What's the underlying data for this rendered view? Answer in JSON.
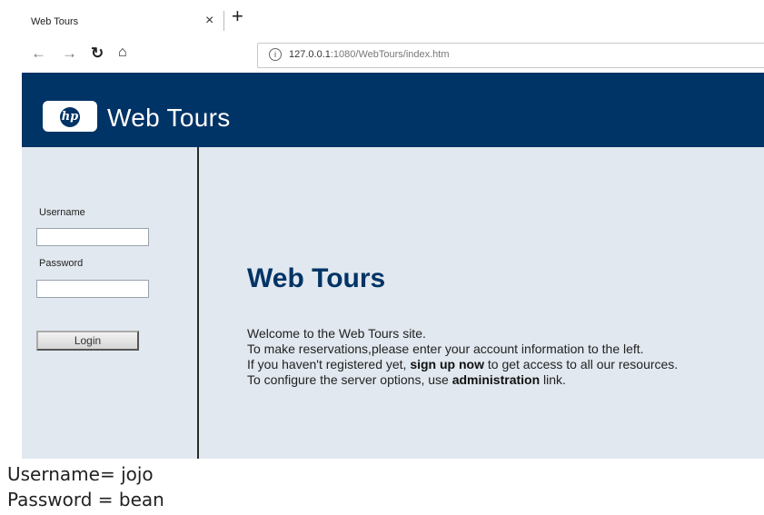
{
  "browser": {
    "tab_title": "Web Tours",
    "tab_close": "×",
    "new_tab": "+",
    "url_host": "127.0.0.1",
    "url_rest": ":1080/WebTours/index.htm"
  },
  "header": {
    "logo_text": "hp",
    "title": "Web Tours"
  },
  "login": {
    "username_label": "Username",
    "username_value": "",
    "password_label": "Password",
    "password_value": "",
    "button_label": "Login"
  },
  "main": {
    "heading": "Web Tours",
    "line1": "Welcome to the Web Tours site.",
    "line2": "To make reservations,please enter your account information to the left.",
    "line3_pre": "If you haven't registered yet, ",
    "line3_link": "sign up now",
    "line3_post": " to get access to all our resources.",
    "line4_pre": "To configure the server options, use ",
    "line4_link": "administration",
    "line4_post": " link."
  },
  "credentials_note": {
    "username": "Username= jojo",
    "password": "Password = bean"
  },
  "colors": {
    "banner": "#003366",
    "panel_bg": "#e1e8ef",
    "heading": "#003366"
  }
}
